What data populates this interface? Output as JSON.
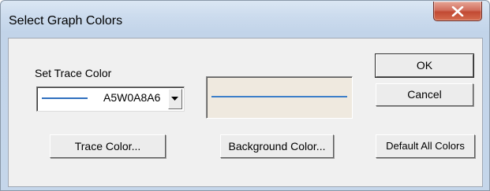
{
  "window": {
    "title": "Select Graph Colors",
    "close_glyph": "✕"
  },
  "trace": {
    "label": "Set Trace Color",
    "selected_value": "A5W0A8A6",
    "line_color": "#2f6fbf"
  },
  "preview": {
    "background_color": "#efe9df",
    "line_color": "#3d7fc9"
  },
  "buttons": {
    "ok": "OK",
    "cancel": "Cancel",
    "trace_color": "Trace Color...",
    "background_color": "Background Color...",
    "default_all_colors": "Default All Colors"
  }
}
